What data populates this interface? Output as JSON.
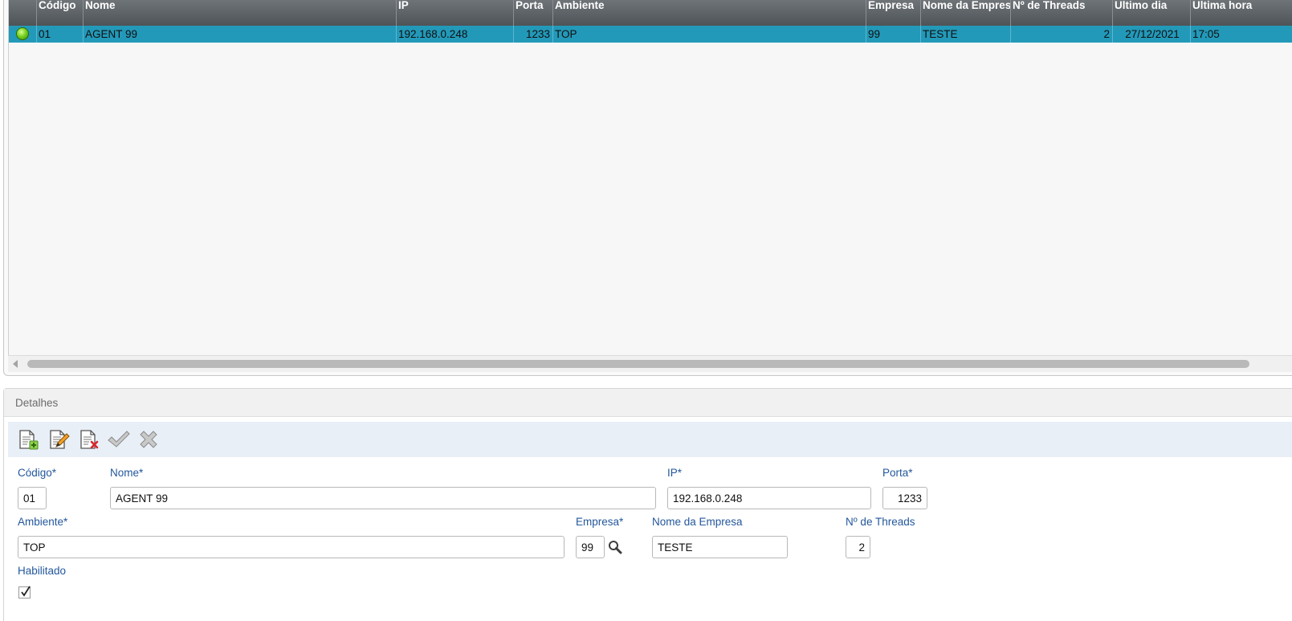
{
  "grid": {
    "columns": [
      {
        "key": "status",
        "label": ""
      },
      {
        "key": "codigo",
        "label": "Código"
      },
      {
        "key": "nome",
        "label": "Nome"
      },
      {
        "key": "ip",
        "label": "IP"
      },
      {
        "key": "porta",
        "label": "Porta"
      },
      {
        "key": "ambiente",
        "label": "Ambiente"
      },
      {
        "key": "empresa",
        "label": "Empresa"
      },
      {
        "key": "nome_empresa",
        "label": "Nome da Empresa"
      },
      {
        "key": "threads",
        "label": "Nº de Threads"
      },
      {
        "key": "ultimo_dia",
        "label": "Ultimo dia"
      },
      {
        "key": "ultima_hora",
        "label": "Ultima hora"
      }
    ],
    "rows": [
      {
        "status": "green-status-icon",
        "codigo": "01",
        "nome": "AGENT 99",
        "ip": "192.168.0.248",
        "porta": "1233",
        "ambiente": "TOP",
        "empresa": "99",
        "nome_empresa": "TESTE",
        "threads": "2",
        "ultimo_dia": "27/12/2021",
        "ultima_hora": "17:05"
      }
    ]
  },
  "details": {
    "title": "Detalhes",
    "toolbar": {
      "new_icon": "new-document-icon",
      "edit_icon": "edit-document-icon",
      "delete_icon": "delete-document-icon",
      "confirm_icon": "check-icon",
      "cancel_icon": "close-icon"
    },
    "fields": {
      "codigo": {
        "label": "Código*",
        "value": "01"
      },
      "nome": {
        "label": "Nome*",
        "value": "AGENT 99"
      },
      "ip": {
        "label": "IP*",
        "value": "192.168.0.248"
      },
      "porta": {
        "label": "Porta*",
        "value": "1233"
      },
      "ambiente": {
        "label": "Ambiente*",
        "value": "TOP"
      },
      "empresa": {
        "label": "Empresa*",
        "value": "99"
      },
      "nome_empresa": {
        "label": "Nome da Empresa",
        "value": "TESTE"
      },
      "threads": {
        "label": "Nº de Threads",
        "value": "2"
      },
      "habilitado": {
        "label": "Habilitado",
        "checked": true
      }
    }
  },
  "colors": {
    "header_bg": "#5d6266",
    "selected_row": "#2399b9",
    "label": "#23579c",
    "toolbar_bg": "#e8eff7"
  }
}
